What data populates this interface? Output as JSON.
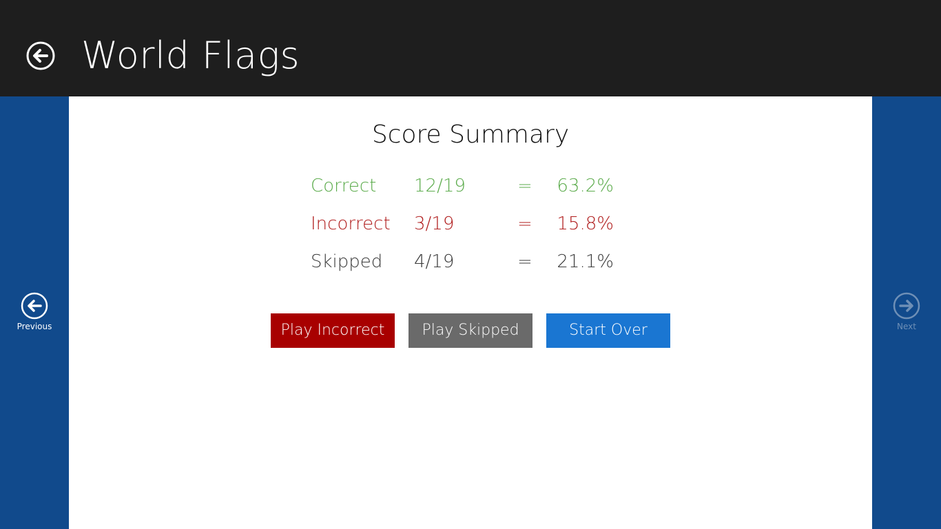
{
  "header": {
    "title": "World Flags",
    "back_icon": "back-arrow-icon"
  },
  "navigation": {
    "previous_label": "Previous",
    "next_label": "Next",
    "next_enabled": false
  },
  "summary": {
    "title": "Score Summary",
    "rows": [
      {
        "label": "Correct",
        "fraction": "12/19",
        "equals": "=",
        "percent": "63.2%",
        "color": "#5bab4b"
      },
      {
        "label": "Incorrect",
        "fraction": "3/19",
        "equals": "=",
        "percent": "15.8%",
        "color": "#b01c1c"
      },
      {
        "label": "Skipped",
        "fraction": "4/19",
        "equals": "=",
        "percent": "21.1%",
        "color": "#3a3a3a"
      }
    ]
  },
  "actions": {
    "play_incorrect": "Play Incorrect",
    "play_skipped": "Play Skipped",
    "start_over": "Start Over"
  },
  "colors": {
    "topbar": "#1e1e1e",
    "side_panels": "#114a8c",
    "play_incorrect_bg": "#a80000",
    "play_skipped_bg": "#6a6a6a",
    "start_over_bg": "#1a76d2"
  }
}
